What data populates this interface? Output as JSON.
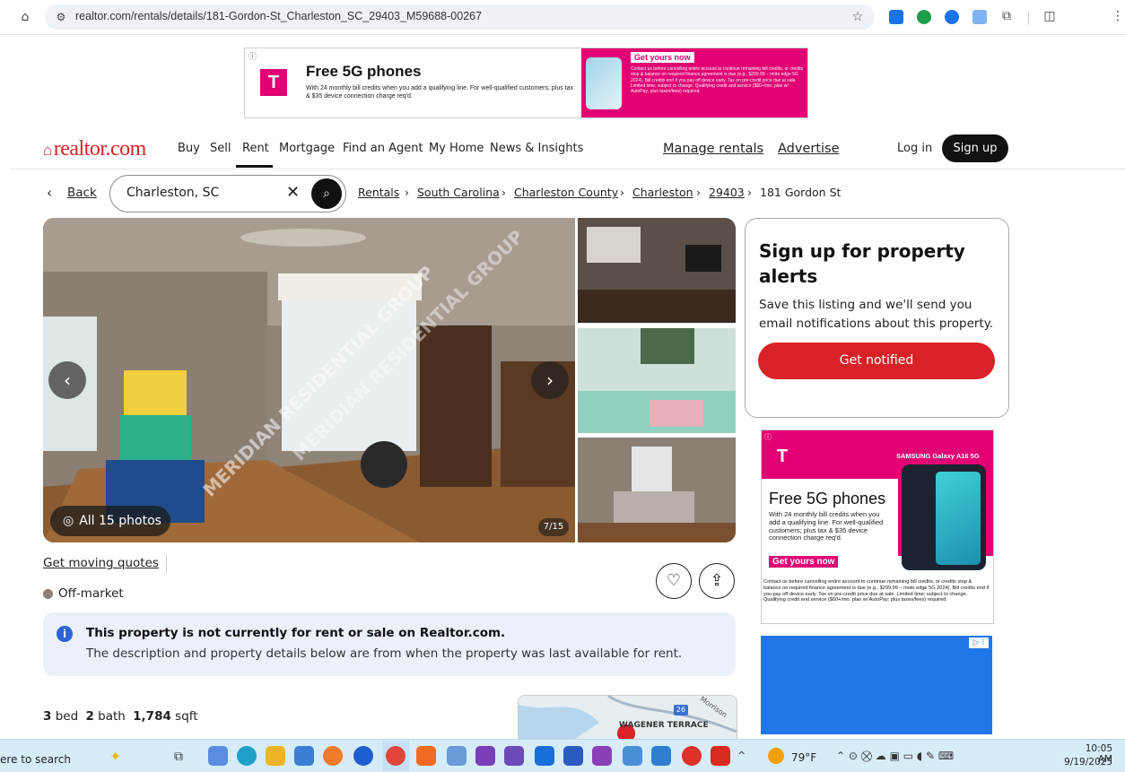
{
  "browser": {
    "url": "realtor.com/rentals/details/181-Gordon-St_Charleston_SC_29403_M59688-00267"
  },
  "top_ad": {
    "headline": "Free 5G phones",
    "body": "With 24 monthly bill credits when you add a qualifying line. For well-qualified customers; plus tax & $35 device connection charge req'd.",
    "cta": "Get yours now",
    "fine_print": "Contact us before cancelling entire account to continue remaining bill credits, or credits stop & balance on required finance agreement is due (e.g., $299.99 – moto edge 5G 2024). Bill credits end if you pay off device early. Tax on pre-credit price due at sale. Limited time; subject to change. Qualifying credit and service ($60+/mo. plan w/ AutoPay; plus taxes/fees) required.",
    "logo_letter": "T"
  },
  "nav": {
    "logo": "realtor.com",
    "items": [
      "Buy",
      "Sell",
      "Rent",
      "Mortgage",
      "Find an Agent",
      "My Home",
      "News & Insights"
    ],
    "active": "Rent",
    "manage_rentals": "Manage rentals",
    "advertise": "Advertise",
    "login": "Log in",
    "signup": "Sign up"
  },
  "search": {
    "back": "Back",
    "value": "Charleston, SC"
  },
  "breadcrumb": {
    "items": [
      "Rentals",
      "South Carolina",
      "Charleston County",
      "Charleston",
      "29403"
    ],
    "current": "181 Gordon St"
  },
  "gallery": {
    "all_photos": "All 15 photos",
    "counter": "7/15",
    "watermark": "MERIDIAN RESIDENTIAL GROUP"
  },
  "alerts": {
    "title": "Sign up for property alerts",
    "body": "Save this listing and we'll send you email notifications about this property.",
    "button": "Get notified"
  },
  "side_ad": {
    "brand": "SAMSUNG Galaxy A16 5G",
    "headline": "Free 5G phones",
    "body": "With 24 monthly bill credits when you add a qualifying line. For well-qualified customers; plus tax & $35 device connection charge req'd.",
    "cta": "Get yours now",
    "fine_print": "Contact us before cancelling entire account to continue remaining bill credits, or credits stop & balance on required finance agreement is due (e.g., $299.99 – moto edge 5G 2024). Bill credits end if you pay off device early. Tax on pre-credit price due at sale. Limited time; subject to change. Qualifying credit and service ($60+/mo. plan w/ AutoPay; plus taxes/fees) required."
  },
  "listing": {
    "moving_quotes": "Get moving quotes",
    "status": "Off-market",
    "notice_title": "This property is not currently for rent or sale on Realtor.com.",
    "notice_body": "The description and property details below are from when the property was last available for rent.",
    "beds": "3",
    "beds_label": "bed",
    "baths": "2",
    "baths_label": "bath",
    "sqft": "1,784",
    "sqft_label": "sqft",
    "map_label": "WAGENER TERRACE",
    "map_street": "Morrison",
    "map_route": "26"
  },
  "taskbar": {
    "search": "ere to search",
    "weather": "79°F",
    "time": "10:05 AM",
    "date": "9/19/2025"
  },
  "colors": {
    "brand_red": "#d92228",
    "tmobile_magenta": "#e20074",
    "notice_bg": "#ebf0fb",
    "info_blue": "#2b62d9"
  }
}
